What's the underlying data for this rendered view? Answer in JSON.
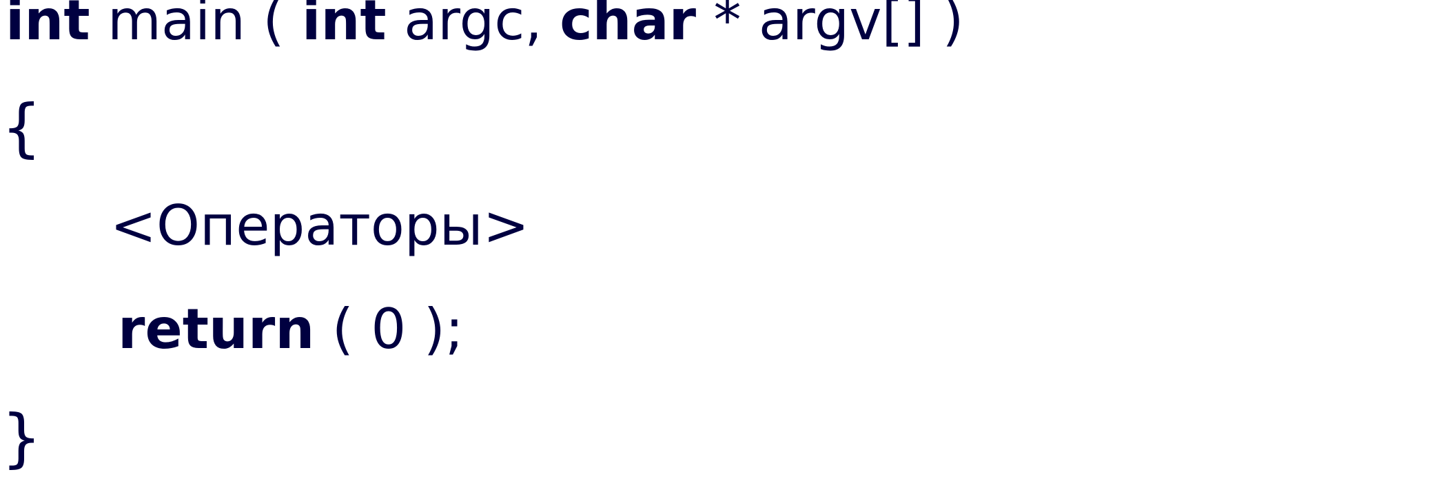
{
  "code": {
    "line1": {
      "kw_int1": "int",
      "text_main": " main ( ",
      "kw_int2": "int",
      "text_argc": " argc, ",
      "kw_char": "char",
      "text_argv": " * argv[] )"
    },
    "line2": {
      "open_brace": "{"
    },
    "line3": {
      "placeholder": "<Операторы>"
    },
    "line4": {
      "kw_return": "return",
      "text_value": " ( 0 );"
    },
    "line5": {
      "close_brace": "}"
    }
  },
  "colors": {
    "text": "#000040",
    "background": "#ffffff"
  }
}
